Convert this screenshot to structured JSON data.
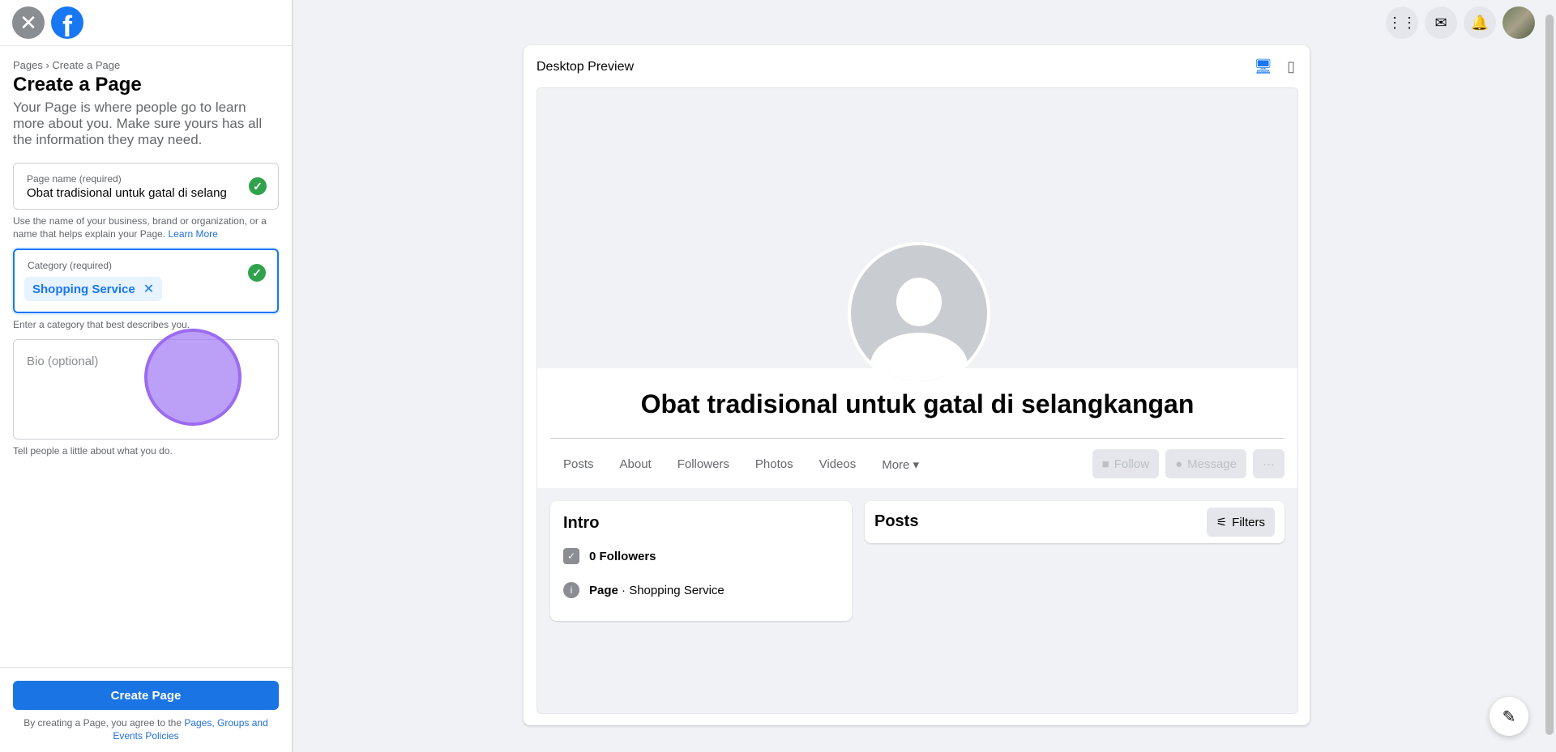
{
  "left_panel": {
    "breadcrumb": "Pages › Create a Page",
    "title": "Create a Page",
    "description": "Your Page is where people go to learn more about you. Make sure yours has all the information they may need.",
    "page_name": {
      "label": "Page name (required)",
      "value": "Obat tradisional untuk gatal di selang",
      "helper_text": "Use the name of your business, brand or organization, or a name that helps explain your Page.",
      "helper_link": "Learn More"
    },
    "category": {
      "label": "Category (required)",
      "chip": "Shopping Service",
      "chip_remove": "✕",
      "helper_text": "Enter a category that best describes you."
    },
    "bio": {
      "placeholder": "Bio (optional)",
      "helper_text": "Tell people a little about what you do."
    },
    "create_button": "Create Page",
    "terms_prefix": "By creating a Page, you agree to the",
    "terms_link": "Pages, Groups and Events Policies"
  },
  "preview": {
    "title": "Desktop Preview",
    "page_name": "Obat tradisional untuk gatal di selangkangan",
    "tabs": [
      "Posts",
      "About",
      "Followers",
      "Photos",
      "Videos",
      "More ▾"
    ],
    "actions": {
      "follow": "Follow",
      "message": "Message",
      "more": "···"
    },
    "intro": {
      "title": "Intro",
      "followers": "0 Followers",
      "page_type_bold": "Page",
      "page_type_rest": " · Shopping Service"
    },
    "posts": {
      "title": "Posts",
      "filters": "Filters"
    }
  },
  "colors": {
    "accent": "#1877f2",
    "success": "#31a24c",
    "cursor": "#9b6cf0"
  }
}
